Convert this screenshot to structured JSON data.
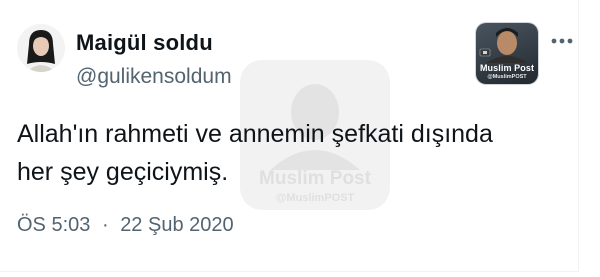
{
  "tweet": {
    "display_name": "Maigül soldu",
    "handle": "@gulikensoldum",
    "text_lines": [
      "Allah'ın rahmeti ve annemin şefkati dışında",
      "her şey geçiciymiş."
    ],
    "time": "ÖS 5:03",
    "separator": "·",
    "date": "22 Şub 2020",
    "more_icon": "more-horizontal-icon"
  },
  "branding": {
    "name": "Muslim Post",
    "handle": "@MuslimPOST"
  },
  "colors": {
    "text": "#0f1419",
    "secondary_text": "#536471",
    "border": "#eff3f4"
  }
}
